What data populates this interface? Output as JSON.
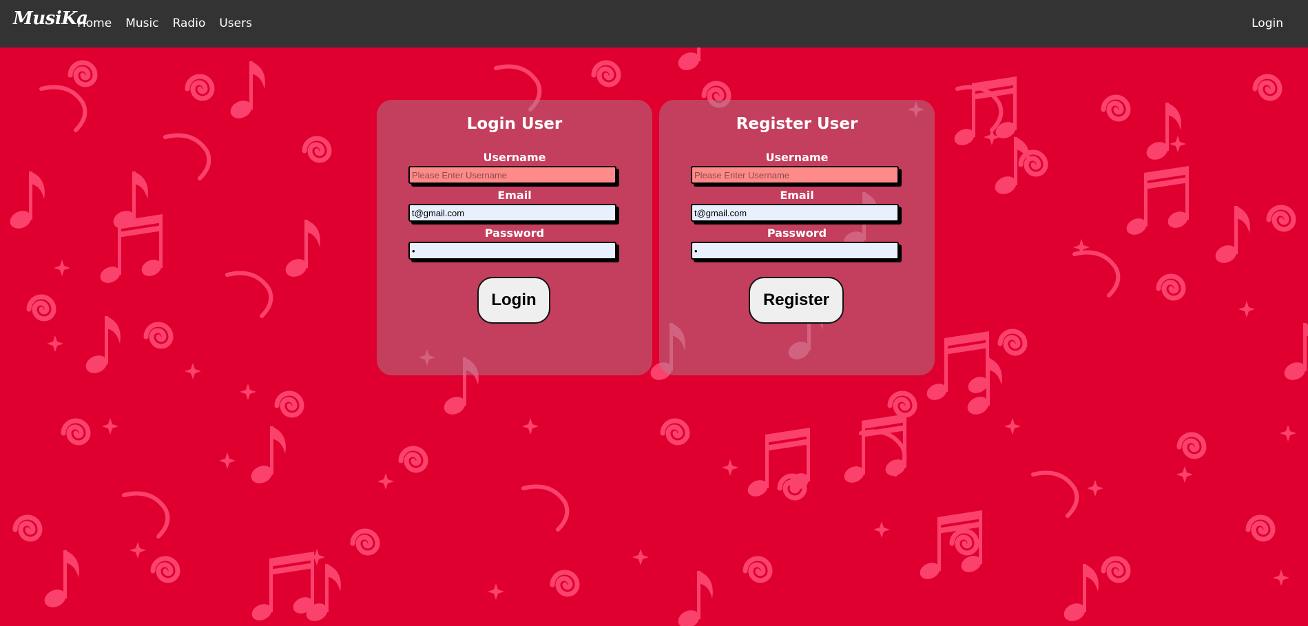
{
  "navbar": {
    "brand": "MusiKa",
    "links": [
      "Home",
      "Music",
      "Radio",
      "Users"
    ],
    "login": "Login"
  },
  "login_card": {
    "title": "Login User",
    "username_label": "Username",
    "username_placeholder": "Please Enter Username",
    "username_value": "",
    "email_label": "Email",
    "email_value": "t@gmail.com",
    "password_label": "Password",
    "password_value": "•",
    "button": "Login"
  },
  "register_card": {
    "title": "Register User",
    "username_label": "Username",
    "username_placeholder": "Please Enter Username",
    "username_value": "",
    "email_label": "Email",
    "email_value": "t@gmail.com",
    "password_label": "Password",
    "password_value": "•",
    "button": "Register"
  },
  "colors": {
    "navbar": "#333333",
    "background": "#e0002f",
    "pattern": "#ff4f79",
    "field_error": "#ff8a8a",
    "field_filled": "#e8f0fe"
  },
  "icons": [
    "music-note-pattern"
  ]
}
